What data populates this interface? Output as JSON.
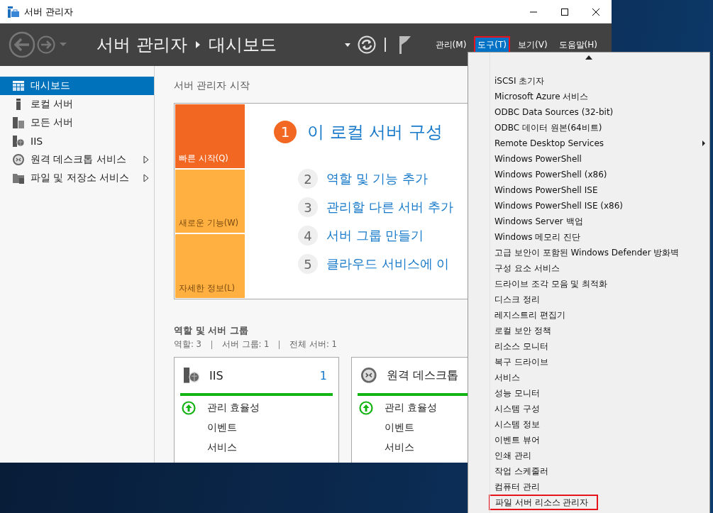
{
  "window": {
    "title": "서버 관리자"
  },
  "header": {
    "breadcrumb": [
      "서버 관리자",
      "대시보드"
    ],
    "menus": [
      {
        "label": "관리(M)",
        "selected": false,
        "annotated": false
      },
      {
        "label": "도구(T)",
        "selected": true,
        "annotated": true
      },
      {
        "label": "보기(V)",
        "selected": false,
        "annotated": false
      },
      {
        "label": "도움말(H)",
        "selected": false,
        "annotated": false
      }
    ]
  },
  "sidebar": {
    "items": [
      {
        "kind": "dashboard",
        "label": "대시보드",
        "selected": true,
        "expandable": false
      },
      {
        "kind": "server",
        "label": "로컬 서버",
        "selected": false,
        "expandable": false
      },
      {
        "kind": "servers",
        "label": "모든 서버",
        "selected": false,
        "expandable": false
      },
      {
        "kind": "iis",
        "label": "IIS",
        "selected": false,
        "expandable": false
      },
      {
        "kind": "remote",
        "label": "원격 데스크톱 서비스",
        "selected": false,
        "expandable": true
      },
      {
        "kind": "files",
        "label": "파일 및 저장소 서비스",
        "selected": false,
        "expandable": true
      }
    ]
  },
  "welcome": {
    "title": "서버 관리자 시작",
    "tiles": [
      {
        "label": "빠른 시작(Q)",
        "selected": true
      },
      {
        "label": "새로운 기능(W)",
        "selected": false
      },
      {
        "label": "자세한 정보(L)",
        "selected": false
      }
    ],
    "steps": [
      {
        "number": "1",
        "label": "이 로컬 서버 구성",
        "primary": true
      },
      {
        "number": "2",
        "label": "역할 및 기능 추가",
        "primary": false
      },
      {
        "number": "3",
        "label": "관리할 다른 서버 추가",
        "primary": false
      },
      {
        "number": "4",
        "label": "서버 그룹 만들기",
        "primary": false
      },
      {
        "number": "5",
        "label": "클라우드 서비스에 이",
        "primary": false
      }
    ]
  },
  "roles": {
    "title": "역할 및 서버 그룹",
    "summary": [
      "역할: 3",
      "서버 그룹: 1",
      "전체 서버: 1"
    ],
    "cards": [
      {
        "kind": "iis",
        "title": "IIS",
        "count": "1",
        "rows": [
          {
            "label": "관리 효율성",
            "healthy": true
          },
          {
            "label": "이벤트",
            "healthy": false
          },
          {
            "label": "서비스",
            "healthy": false
          }
        ]
      },
      {
        "kind": "remote",
        "title": "원격 데스크톱",
        "rows": [
          {
            "label": "관리 효율성",
            "healthy": true
          },
          {
            "label": "이벤트",
            "healthy": false
          },
          {
            "label": "서비스",
            "healthy": false
          }
        ]
      }
    ]
  },
  "tools_menu": {
    "items": [
      {
        "label": "iSCSI 초기자",
        "submenu": false,
        "annotated": false
      },
      {
        "label": "Microsoft Azure 서비스",
        "submenu": false,
        "annotated": false
      },
      {
        "label": "ODBC Data Sources (32-bit)",
        "submenu": false,
        "annotated": false
      },
      {
        "label": "ODBC 데이터 원본(64비트)",
        "submenu": false,
        "annotated": false
      },
      {
        "label": "Remote Desktop Services",
        "submenu": true,
        "annotated": false
      },
      {
        "label": "Windows PowerShell",
        "submenu": false,
        "annotated": false
      },
      {
        "label": "Windows PowerShell (x86)",
        "submenu": false,
        "annotated": false
      },
      {
        "label": "Windows PowerShell ISE",
        "submenu": false,
        "annotated": false
      },
      {
        "label": "Windows PowerShell ISE (x86)",
        "submenu": false,
        "annotated": false
      },
      {
        "label": "Windows Server 백업",
        "submenu": false,
        "annotated": false
      },
      {
        "label": "Windows 메모리 진단",
        "submenu": false,
        "annotated": false
      },
      {
        "label": "고급 보안이 포함된 Windows Defender 방화벽",
        "submenu": false,
        "annotated": false
      },
      {
        "label": "구성 요소 서비스",
        "submenu": false,
        "annotated": false
      },
      {
        "label": "드라이브 조각 모음 및 최적화",
        "submenu": false,
        "annotated": false
      },
      {
        "label": "디스크 정리",
        "submenu": false,
        "annotated": false
      },
      {
        "label": "레지스트리 편집기",
        "submenu": false,
        "annotated": false
      },
      {
        "label": "로컬 보안 정책",
        "submenu": false,
        "annotated": false
      },
      {
        "label": "리소스 모니터",
        "submenu": false,
        "annotated": false
      },
      {
        "label": "복구 드라이브",
        "submenu": false,
        "annotated": false
      },
      {
        "label": "서비스",
        "submenu": false,
        "annotated": false
      },
      {
        "label": "성능 모니터",
        "submenu": false,
        "annotated": false
      },
      {
        "label": "시스템 구성",
        "submenu": false,
        "annotated": false
      },
      {
        "label": "시스템 정보",
        "submenu": false,
        "annotated": false
      },
      {
        "label": "이벤트 뷰어",
        "submenu": false,
        "annotated": false
      },
      {
        "label": "인쇄 관리",
        "submenu": false,
        "annotated": false
      },
      {
        "label": "작업 스케줄러",
        "submenu": false,
        "annotated": false
      },
      {
        "label": "컴퓨터 관리",
        "submenu": false,
        "annotated": false
      },
      {
        "label": "파일 서버 리소스 관리자",
        "submenu": false,
        "annotated": true
      }
    ]
  }
}
